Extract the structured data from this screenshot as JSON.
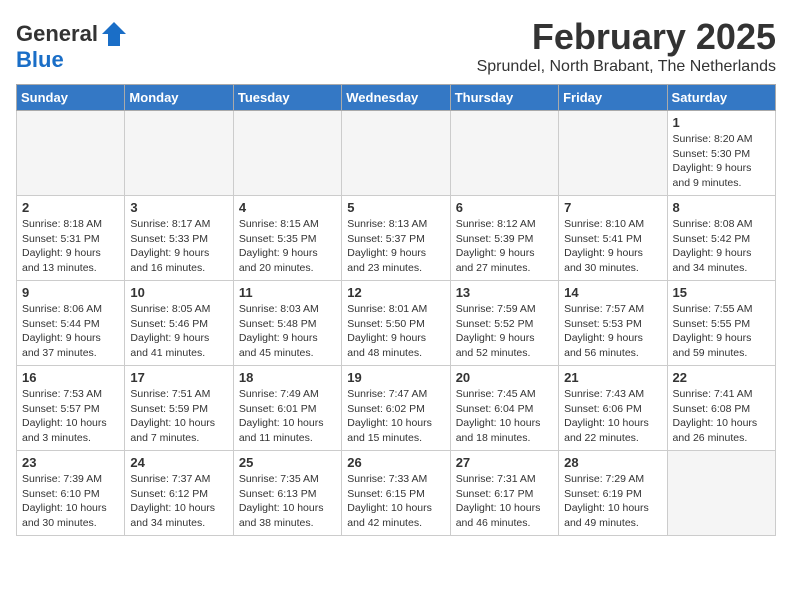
{
  "logo": {
    "line1": "General",
    "line2": "Blue"
  },
  "title": "February 2025",
  "location": "Sprundel, North Brabant, The Netherlands",
  "weekdays": [
    "Sunday",
    "Monday",
    "Tuesday",
    "Wednesday",
    "Thursday",
    "Friday",
    "Saturday"
  ],
  "weeks": [
    [
      {
        "day": "",
        "info": ""
      },
      {
        "day": "",
        "info": ""
      },
      {
        "day": "",
        "info": ""
      },
      {
        "day": "",
        "info": ""
      },
      {
        "day": "",
        "info": ""
      },
      {
        "day": "",
        "info": ""
      },
      {
        "day": "1",
        "info": "Sunrise: 8:20 AM\nSunset: 5:30 PM\nDaylight: 9 hours and 9 minutes."
      }
    ],
    [
      {
        "day": "2",
        "info": "Sunrise: 8:18 AM\nSunset: 5:31 PM\nDaylight: 9 hours and 13 minutes."
      },
      {
        "day": "3",
        "info": "Sunrise: 8:17 AM\nSunset: 5:33 PM\nDaylight: 9 hours and 16 minutes."
      },
      {
        "day": "4",
        "info": "Sunrise: 8:15 AM\nSunset: 5:35 PM\nDaylight: 9 hours and 20 minutes."
      },
      {
        "day": "5",
        "info": "Sunrise: 8:13 AM\nSunset: 5:37 PM\nDaylight: 9 hours and 23 minutes."
      },
      {
        "day": "6",
        "info": "Sunrise: 8:12 AM\nSunset: 5:39 PM\nDaylight: 9 hours and 27 minutes."
      },
      {
        "day": "7",
        "info": "Sunrise: 8:10 AM\nSunset: 5:41 PM\nDaylight: 9 hours and 30 minutes."
      },
      {
        "day": "8",
        "info": "Sunrise: 8:08 AM\nSunset: 5:42 PM\nDaylight: 9 hours and 34 minutes."
      }
    ],
    [
      {
        "day": "9",
        "info": "Sunrise: 8:06 AM\nSunset: 5:44 PM\nDaylight: 9 hours and 37 minutes."
      },
      {
        "day": "10",
        "info": "Sunrise: 8:05 AM\nSunset: 5:46 PM\nDaylight: 9 hours and 41 minutes."
      },
      {
        "day": "11",
        "info": "Sunrise: 8:03 AM\nSunset: 5:48 PM\nDaylight: 9 hours and 45 minutes."
      },
      {
        "day": "12",
        "info": "Sunrise: 8:01 AM\nSunset: 5:50 PM\nDaylight: 9 hours and 48 minutes."
      },
      {
        "day": "13",
        "info": "Sunrise: 7:59 AM\nSunset: 5:52 PM\nDaylight: 9 hours and 52 minutes."
      },
      {
        "day": "14",
        "info": "Sunrise: 7:57 AM\nSunset: 5:53 PM\nDaylight: 9 hours and 56 minutes."
      },
      {
        "day": "15",
        "info": "Sunrise: 7:55 AM\nSunset: 5:55 PM\nDaylight: 9 hours and 59 minutes."
      }
    ],
    [
      {
        "day": "16",
        "info": "Sunrise: 7:53 AM\nSunset: 5:57 PM\nDaylight: 10 hours and 3 minutes."
      },
      {
        "day": "17",
        "info": "Sunrise: 7:51 AM\nSunset: 5:59 PM\nDaylight: 10 hours and 7 minutes."
      },
      {
        "day": "18",
        "info": "Sunrise: 7:49 AM\nSunset: 6:01 PM\nDaylight: 10 hours and 11 minutes."
      },
      {
        "day": "19",
        "info": "Sunrise: 7:47 AM\nSunset: 6:02 PM\nDaylight: 10 hours and 15 minutes."
      },
      {
        "day": "20",
        "info": "Sunrise: 7:45 AM\nSunset: 6:04 PM\nDaylight: 10 hours and 18 minutes."
      },
      {
        "day": "21",
        "info": "Sunrise: 7:43 AM\nSunset: 6:06 PM\nDaylight: 10 hours and 22 minutes."
      },
      {
        "day": "22",
        "info": "Sunrise: 7:41 AM\nSunset: 6:08 PM\nDaylight: 10 hours and 26 minutes."
      }
    ],
    [
      {
        "day": "23",
        "info": "Sunrise: 7:39 AM\nSunset: 6:10 PM\nDaylight: 10 hours and 30 minutes."
      },
      {
        "day": "24",
        "info": "Sunrise: 7:37 AM\nSunset: 6:12 PM\nDaylight: 10 hours and 34 minutes."
      },
      {
        "day": "25",
        "info": "Sunrise: 7:35 AM\nSunset: 6:13 PM\nDaylight: 10 hours and 38 minutes."
      },
      {
        "day": "26",
        "info": "Sunrise: 7:33 AM\nSunset: 6:15 PM\nDaylight: 10 hours and 42 minutes."
      },
      {
        "day": "27",
        "info": "Sunrise: 7:31 AM\nSunset: 6:17 PM\nDaylight: 10 hours and 46 minutes."
      },
      {
        "day": "28",
        "info": "Sunrise: 7:29 AM\nSunset: 6:19 PM\nDaylight: 10 hours and 49 minutes."
      },
      {
        "day": "",
        "info": ""
      }
    ]
  ]
}
